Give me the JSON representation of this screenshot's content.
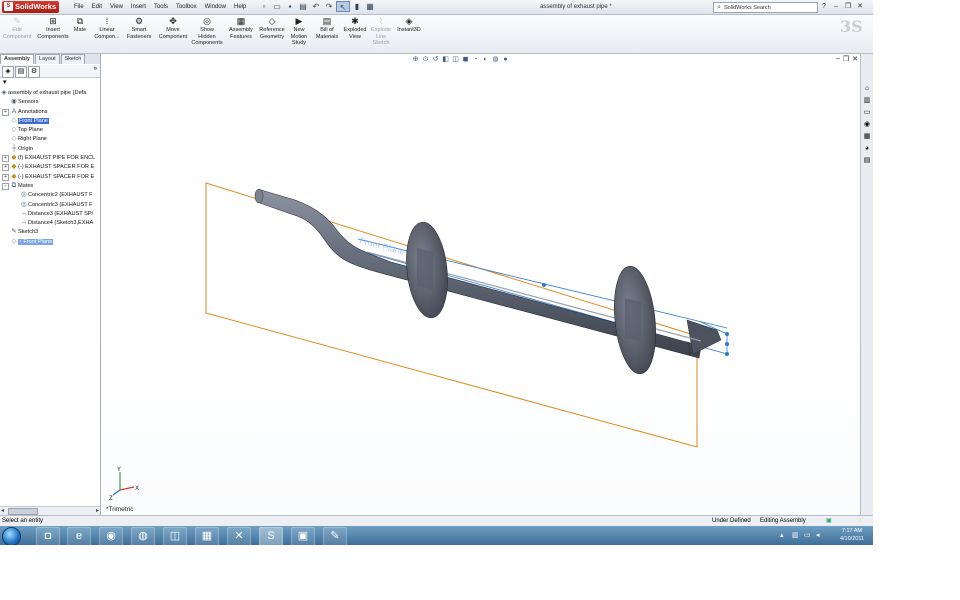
{
  "app": {
    "name": "SolidWorks",
    "document_title": "assembly of exhaust pipe *",
    "menus": [
      "File",
      "Edit",
      "View",
      "Insert",
      "Tools",
      "Toolbox",
      "Window",
      "Help"
    ],
    "search_placeholder": "SolidWorks Search"
  },
  "commands": [
    {
      "label": "Edit\nComponent",
      "icon": "edit-component-icon",
      "enabled": false
    },
    {
      "label": "Insert\nComponents",
      "icon": "insert-components-icon",
      "enabled": true
    },
    {
      "label": "Mate",
      "icon": "mate-icon",
      "enabled": true
    },
    {
      "label": "Linear\nCompon...",
      "icon": "linear-pattern-icon",
      "enabled": true
    },
    {
      "label": "Smart\nFasteners",
      "icon": "smart-fasteners-icon",
      "enabled": true
    },
    {
      "label": "Move\nComponent",
      "icon": "move-component-icon",
      "enabled": true
    },
    {
      "label": "Show\nHidden\nComponents",
      "icon": "show-hidden-icon",
      "enabled": true
    },
    {
      "label": "Assembly\nFeatures",
      "icon": "assembly-features-icon",
      "enabled": true
    },
    {
      "label": "Reference\nGeometry",
      "icon": "reference-geometry-icon",
      "enabled": true
    },
    {
      "label": "New\nMotion\nStudy",
      "icon": "motion-study-icon",
      "enabled": true
    },
    {
      "label": "Bill of\nMaterials",
      "icon": "bom-icon",
      "enabled": true
    },
    {
      "label": "Exploded\nView",
      "icon": "exploded-view-icon",
      "enabled": true
    },
    {
      "label": "Explode\nLine\nSketch",
      "icon": "explode-line-icon",
      "enabled": false
    },
    {
      "label": "Instant3D",
      "icon": "instant3d-icon",
      "enabled": true
    }
  ],
  "tabs": [
    "Assembly",
    "Layout",
    "Sketch"
  ],
  "tree": [
    {
      "label": "assembly of exhaust pipe  (Defa",
      "icon": "assembly-icon",
      "level": 0,
      "expand": ""
    },
    {
      "label": "Sensors",
      "icon": "sensors-icon",
      "level": 1,
      "expand": ""
    },
    {
      "label": "Annotations",
      "icon": "annotations-icon",
      "level": 1,
      "expand": "+"
    },
    {
      "label": "Front Plane",
      "icon": "plane-icon",
      "level": 1,
      "expand": "",
      "highlight": true
    },
    {
      "label": "Top Plane",
      "icon": "plane-icon",
      "level": 1,
      "expand": ""
    },
    {
      "label": "Right Plane",
      "icon": "plane-icon",
      "level": 1,
      "expand": ""
    },
    {
      "label": "Origin",
      "icon": "origin-icon",
      "level": 1,
      "expand": ""
    },
    {
      "label": "(f) EXHAUST PIPE FOR ENCL",
      "icon": "part-icon",
      "level": 1,
      "expand": "+"
    },
    {
      "label": "(-) EXHAUST SPACER FOR E",
      "icon": "part-icon",
      "level": 1,
      "expand": "+"
    },
    {
      "label": "(-) EXHAUST SPACER FOR E",
      "icon": "part-icon",
      "level": 1,
      "expand": "+"
    },
    {
      "label": "Mates",
      "icon": "mates-icon",
      "level": 1,
      "expand": "-"
    },
    {
      "label": "Concentric2 (EXHAUST F",
      "icon": "concentric-icon",
      "level": 2,
      "expand": ""
    },
    {
      "label": "Concentric3 (EXHAUST F",
      "icon": "concentric-icon",
      "level": 2,
      "expand": ""
    },
    {
      "label": "Distance3 (EXHAUST SP/",
      "icon": "distance-icon",
      "level": 2,
      "expand": ""
    },
    {
      "label": "Distance4 (Sketch3,EXHA",
      "icon": "distance-icon",
      "level": 2,
      "expand": ""
    },
    {
      "label": "Sketch3",
      "icon": "sketch-icon",
      "level": 1,
      "expand": ""
    },
    {
      "label": "↑ Front Plane",
      "icon": "plane-icon",
      "level": 1,
      "expand": "",
      "highlight2": true
    }
  ],
  "viewport": {
    "view_label": "*Trimetric",
    "preview_label": "Front Plane"
  },
  "status": {
    "left": "Select an entity",
    "state": "Under Defined",
    "mode": "Editing Assembly"
  },
  "clock": {
    "time": "7:17 AM",
    "date": "4/10/2011"
  },
  "colors": {
    "plane": "#e08a1e",
    "selection": "#2e7bd6",
    "pipe": "#5b6272",
    "tree_highlight": "#3d6fd1"
  }
}
